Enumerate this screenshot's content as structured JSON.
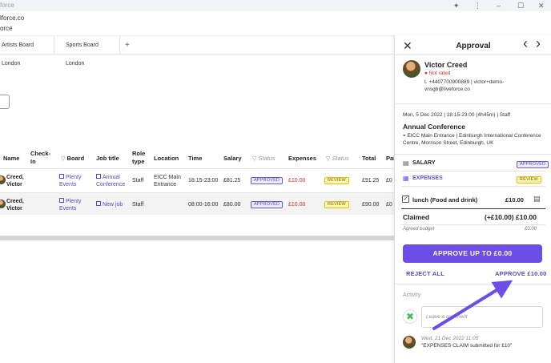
{
  "browser": {
    "window_title": "force",
    "url_line1": "lforce.co",
    "url_line2": "orce"
  },
  "tabs": [
    {
      "label": "Artists Board London"
    },
    {
      "label": "Sports Board London"
    }
  ],
  "tab_add": "+",
  "table": {
    "headers": {
      "name": "Name",
      "checkin": "Check-In",
      "board": "Board",
      "job_title": "Job title",
      "role_type": "Role type",
      "location": "Location",
      "time": "Time",
      "salary": "Salary",
      "status1": "Status",
      "expenses": "Expenses",
      "status2": "Status",
      "total": "Total",
      "paid": "Pai"
    },
    "rows": [
      {
        "name": "Creed, Victor",
        "board": "Plenty Events",
        "job_title": "Annual Conference",
        "role_type": "Staff",
        "location": "EICC Main Entrance",
        "time": "18:15-23:00",
        "salary": "£81.25",
        "status1": "APPROVED",
        "expenses": "£10.00",
        "status2": "REVIEW",
        "total": "£91.25",
        "paid": "£0"
      },
      {
        "name": "Creed, Victor",
        "board": "Plenty Events",
        "job_title": "New job",
        "role_type": "Staff",
        "location": "",
        "time": "08:00-16:00",
        "salary": "£80.00",
        "status1": "APPROVED",
        "expenses": "£10.00",
        "status2": "REVIEW",
        "total": "£90.00",
        "paid": "£0"
      }
    ]
  },
  "panel": {
    "title": "Approval",
    "close": "✕",
    "prev": "‹",
    "next": "›",
    "person": {
      "name": "Victor Creed",
      "rating": "Not rated",
      "contact": "t. +4407700900889 | victor+demo-vnsgb@liveforce.co"
    },
    "shift": {
      "datetime": "Mon, 5 Dec 2022 | 18:15-23:00 (4h45m) | Staff",
      "event": "Annual Conference",
      "address": "EICC Main Entrance | Edinburgh International Conference Centre, Morrison Street, Edinburgh, UK"
    },
    "salary": {
      "label": "SALARY",
      "status": "APPROVED"
    },
    "expenses": {
      "label": "EXPENSES",
      "status": "REVIEW"
    },
    "expense_item": {
      "label": "lunch (Food and drink)",
      "amount": "£10.00"
    },
    "claimed": {
      "label": "Claimed",
      "value": "(+£10.00) £10.00"
    },
    "agreed": {
      "label": "Agreed budget",
      "value": "£0.00"
    },
    "approve_up_to": "APPROVE UP TO £0.00",
    "reject_all": "REJECT ALL",
    "approve": "APPROVE £10.00",
    "activity": {
      "heading": "Activity",
      "comment_placeholder": "Leave a comment",
      "entry_time": "Wed, 21 Dec 2022 11:05",
      "entry_text": "\"EXPENSES CLAIM submitted for £10\""
    }
  },
  "colors": {
    "accent": "#6b4ee6",
    "danger": "#d32f2f",
    "review": "#fff6b3"
  }
}
